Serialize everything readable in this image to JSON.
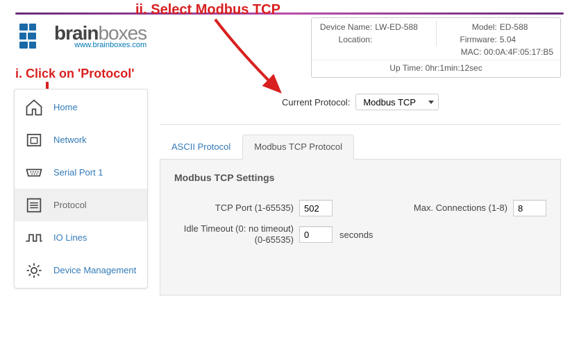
{
  "logo": {
    "brain": "brain",
    "boxes": "boxes",
    "url": "www.brainboxes.com"
  },
  "annotations": {
    "step_i": "i. Click on 'Protocol'",
    "step_ii": "ii. Select Modbus TCP"
  },
  "info": {
    "device_name_label": "Device Name:",
    "device_name_value": "LW-ED-588",
    "location_label": "Location:",
    "location_value": "",
    "model_label": "Model:",
    "model_value": "ED-588",
    "firmware_label": "Firmware:",
    "firmware_value": "5.04",
    "mac_label": "MAC:",
    "mac_value": "00:0A:4F:05:17:B5",
    "uptime_label": "Up Time:",
    "uptime_value": "0hr:1min:12sec"
  },
  "sidebar": {
    "items": [
      {
        "label": "Home"
      },
      {
        "label": "Network"
      },
      {
        "label": "Serial Port 1"
      },
      {
        "label": "Protocol"
      },
      {
        "label": "IO Lines"
      },
      {
        "label": "Device Management"
      }
    ]
  },
  "main": {
    "current_protocol_label": "Current Protocol:",
    "current_protocol_value": "Modbus TCP",
    "tabs": {
      "ascii": "ASCII Protocol",
      "modbus": "Modbus TCP Protocol"
    },
    "settings": {
      "title": "Modbus TCP Settings",
      "tcp_port_label": "TCP Port (1-65535)",
      "tcp_port_value": "502",
      "max_conn_label": "Max. Connections (1-8)",
      "max_conn_value": "8",
      "idle_label_top": "Idle Timeout (0: no timeout)",
      "idle_label_bot": "(0-65535)",
      "idle_value": "0",
      "idle_suffix": "seconds"
    }
  }
}
